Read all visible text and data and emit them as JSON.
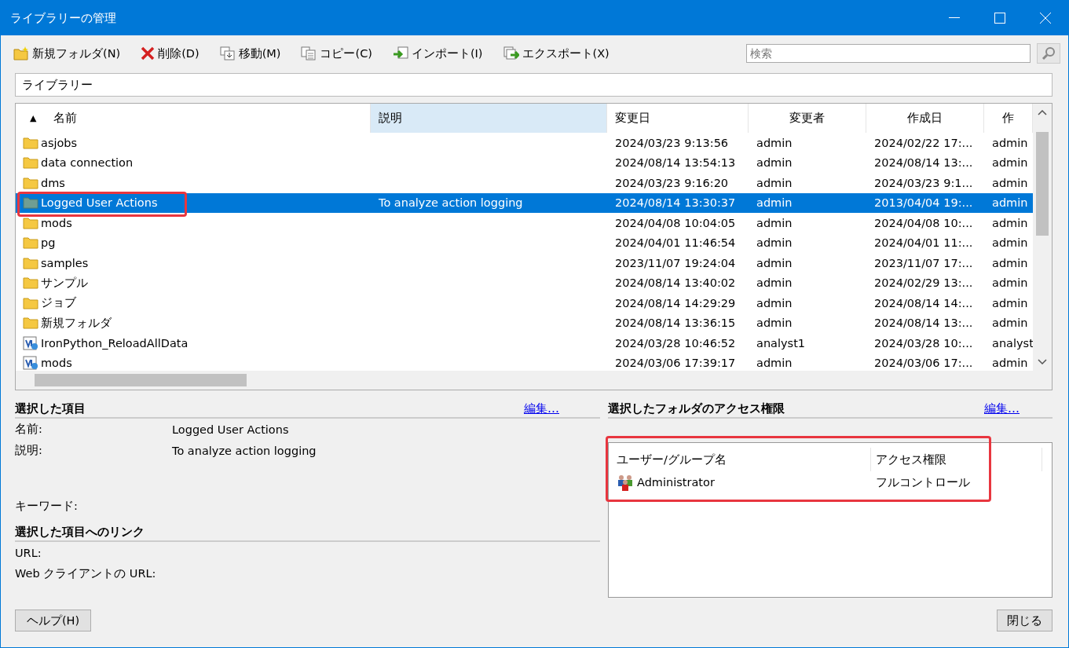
{
  "window": {
    "title": "ライブラリーの管理"
  },
  "toolbar": [
    {
      "kind": "new-folder",
      "label": "新規フォルダ(N)"
    },
    {
      "kind": "delete",
      "label": "削除(D)"
    },
    {
      "kind": "move",
      "label": "移動(M)"
    },
    {
      "kind": "copy",
      "label": "コピー(C)"
    },
    {
      "kind": "import",
      "label": "インポート(I)"
    },
    {
      "kind": "export",
      "label": "エクスポート(X)"
    }
  ],
  "search": {
    "placeholder": "検索"
  },
  "path": {
    "value": "ライブラリー"
  },
  "table": {
    "columns": [
      {
        "label": "名前",
        "sort_indicator": "▲",
        "highlighted": false
      },
      {
        "label": "説明",
        "highlighted": true
      },
      {
        "label": "変更日",
        "highlighted": false
      },
      {
        "label": "変更者",
        "highlighted": false
      },
      {
        "label": "作成日",
        "highlighted": false
      },
      {
        "label": "作",
        "highlighted": false
      }
    ],
    "rows": [
      {
        "kind": "folder",
        "name": "asjobs",
        "modified": "2024/03/23 9:13:56",
        "modified_by": "admin",
        "created": "2024/02/22 17:...",
        "column_6": "admin",
        "selected": false
      },
      {
        "kind": "folder",
        "name": "data connection",
        "modified": "2024/08/14 13:54:13",
        "modified_by": "admin",
        "created": "2024/08/14 13:...",
        "column_6": "admin",
        "selected": false
      },
      {
        "kind": "folder",
        "name": "dms",
        "modified": "2024/03/23 9:16:20",
        "modified_by": "admin",
        "created": "2024/03/23 9:1...",
        "column_6": "admin",
        "selected": false
      },
      {
        "kind": "folder",
        "name": "Logged User Actions",
        "description": "To analyze action logging",
        "modified": "2024/08/14 13:30:37",
        "modified_by": "admin",
        "created": "2013/04/04 19:...",
        "column_6": "admin",
        "selected": true
      },
      {
        "kind": "folder",
        "name": "mods",
        "modified": "2024/04/08 10:04:05",
        "modified_by": "admin",
        "created": "2024/04/08 10:...",
        "column_6": "admin",
        "selected": false
      },
      {
        "kind": "folder",
        "name": "pg",
        "modified": "2024/04/01 11:46:54",
        "modified_by": "admin",
        "created": "2024/04/01 11:...",
        "column_6": "admin",
        "selected": false
      },
      {
        "kind": "folder",
        "name": "samples",
        "modified": "2023/11/07 19:24:04",
        "modified_by": "admin",
        "created": "2023/11/07 17:...",
        "column_6": "admin",
        "selected": false
      },
      {
        "kind": "folder",
        "name": "サンプル",
        "modified": "2024/08/14 13:40:02",
        "modified_by": "admin",
        "created": "2024/02/29 13:...",
        "column_6": "admin",
        "selected": false
      },
      {
        "kind": "folder",
        "name": "ジョブ",
        "modified": "2024/08/14 14:29:29",
        "modified_by": "admin",
        "created": "2024/08/14 14:...",
        "column_6": "admin",
        "selected": false
      },
      {
        "kind": "folder",
        "name": "新規フォルダ",
        "modified": "2024/08/14 13:36:15",
        "modified_by": "admin",
        "created": "2024/08/14 13:...",
        "column_6": "admin",
        "selected": false
      },
      {
        "kind": "script",
        "name": "IronPython_ReloadAllData",
        "modified": "2024/03/28 10:46:52",
        "modified_by": "analyst1",
        "created": "2024/03/28 10:...",
        "column_6": "analyst",
        "selected": false
      },
      {
        "kind": "script",
        "name": "mods",
        "modified": "2024/03/06 17:39:17",
        "modified_by": "admin",
        "created": "2024/03/06 17:...",
        "column_6": "admin",
        "selected": false
      }
    ]
  },
  "details": {
    "title": "選択した項目",
    "edit_link": "編集…",
    "fields": [
      {
        "label": "名前:",
        "value": "Logged User Actions"
      },
      {
        "label": "説明:",
        "value": "To analyze action logging"
      },
      {
        "label": "キーワード:"
      }
    ],
    "links_title": "選択した項目へのリンク",
    "links": [
      {
        "label": "URL:"
      },
      {
        "label": "Web クライアントの URL:"
      }
    ]
  },
  "permissions": {
    "title": "選択したフォルダのアクセス権限",
    "edit_link": "編集…",
    "columns": [
      "ユーザー/グループ名",
      "アクセス権限"
    ],
    "rows": [
      {
        "name": "Administrator",
        "access": "フルコントロール"
      }
    ]
  },
  "buttons": {
    "help": "ヘルプ(H)",
    "close": "閉じる"
  }
}
